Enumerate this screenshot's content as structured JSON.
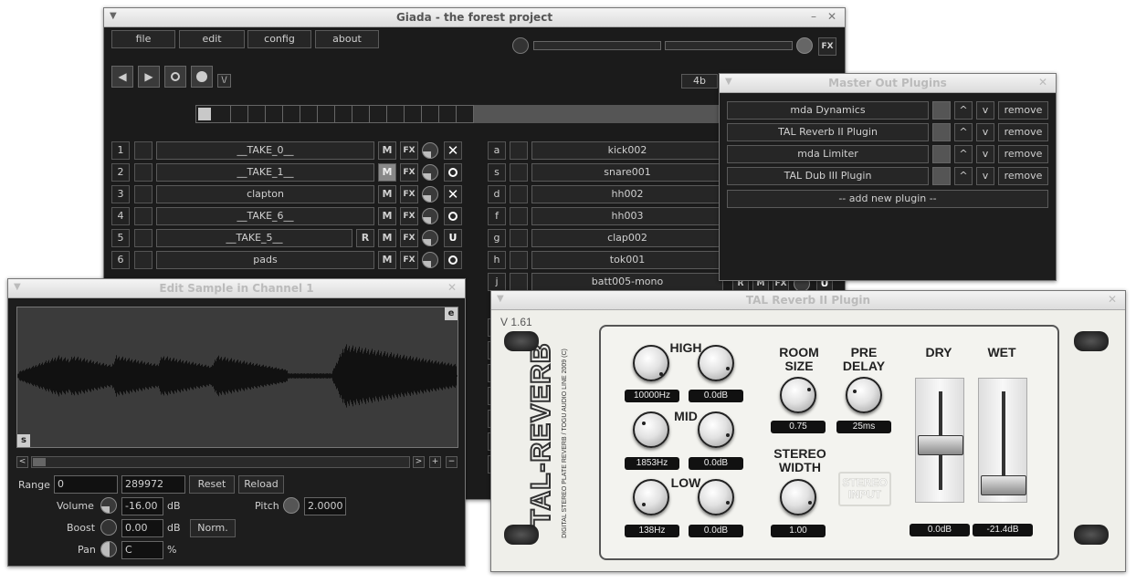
{
  "main_window": {
    "title": "Giada - the forest project",
    "menu": [
      "file",
      "edit",
      "config",
      "about"
    ],
    "fx_label": "FX",
    "beats_label": "4b",
    "channels_left": [
      {
        "index": "1",
        "name": "__TAKE_0__",
        "mute": "M",
        "fx": "FX",
        "status": "x"
      },
      {
        "index": "2",
        "name": "__TAKE_1__",
        "mute": "M",
        "fx": "FX",
        "status": "o"
      },
      {
        "index": "3",
        "name": "clapton",
        "mute": "M",
        "fx": "FX",
        "status": "x"
      },
      {
        "index": "4",
        "name": "__TAKE_6__",
        "mute": "M",
        "fx": "FX",
        "status": "o"
      },
      {
        "index": "5",
        "name": "__TAKE_5__",
        "rec": "R",
        "mute": "M",
        "fx": "FX",
        "status": "u"
      },
      {
        "index": "6",
        "name": "pads",
        "mute": "M",
        "fx": "FX",
        "status": "o"
      }
    ],
    "channels_right": [
      {
        "key": "a",
        "name": "kick002"
      },
      {
        "key": "s",
        "name": "snare001"
      },
      {
        "key": "d",
        "name": "hh002"
      },
      {
        "key": "f",
        "name": "hh003"
      },
      {
        "key": "g",
        "name": "clap002"
      },
      {
        "key": "h",
        "name": "tok001"
      },
      {
        "key": "j",
        "name": "batt005-mono"
      }
    ],
    "partial_buttons": {
      "rec": "R",
      "mute": "M",
      "fx": "FX"
    }
  },
  "master_plugins": {
    "title": "Master Out Plugins",
    "plugins": [
      {
        "name": "mda Dynamics",
        "up": "^",
        "down": "v",
        "remove": "remove"
      },
      {
        "name": "TAL Reverb II Plugin",
        "up": "^",
        "down": "v",
        "remove": "remove"
      },
      {
        "name": "mda Limiter",
        "up": "^",
        "down": "v",
        "remove": "remove"
      },
      {
        "name": "TAL Dub III Plugin",
        "up": "^",
        "down": "v",
        "remove": "remove"
      }
    ],
    "add_label": "-- add new plugin --"
  },
  "edit_sample": {
    "title": "Edit Sample in Channel 1",
    "corner_e": "e",
    "corner_s": "s",
    "scroll": {
      "left": "<",
      "right": ">",
      "plus": "+",
      "minus": "−"
    },
    "range_label": "Range",
    "range_start": "0",
    "range_end": "289972",
    "reset": "Reset",
    "reload": "Reload",
    "volume_label": "Volume",
    "volume_value": "-16.00",
    "volume_unit": "dB",
    "pitch_label": "Pitch",
    "pitch_value": "2.0000",
    "boost_label": "Boost",
    "boost_value": "0.00",
    "boost_unit": "dB",
    "normalize": "Norm.",
    "pan_label": "Pan",
    "pan_value": "C",
    "pan_unit": "%"
  },
  "reverb": {
    "title": "TAL Reverb II Plugin",
    "version": "V 1.61",
    "brand": "TAL-REVERB",
    "brand_sub": "DIGITAL STEREO PLATE REVERB / TOGU AUDIO LINE 2009 (C)",
    "high_label": "HIGH",
    "mid_label": "MID",
    "low_label": "LOW",
    "high_freq": "10000Hz",
    "high_gain": "0.0dB",
    "mid_freq": "1853Hz",
    "mid_gain": "0.0dB",
    "low_freq": "138Hz",
    "low_gain": "0.0dB",
    "room_label_1": "ROOM",
    "room_label_2": "SIZE",
    "room_value": "0.75",
    "pre_label_1": "PRE",
    "pre_label_2": "DELAY",
    "pre_value": "25ms",
    "stereo_label_1": "STEREO",
    "stereo_label_2": "WIDTH",
    "stereo_value": "1.00",
    "stereo_input_1": "STEREO",
    "stereo_input_2": "INPUT",
    "dry_label": "DRY",
    "dry_value": "0.0dB",
    "wet_label": "WET",
    "wet_value": "-21.4dB"
  }
}
